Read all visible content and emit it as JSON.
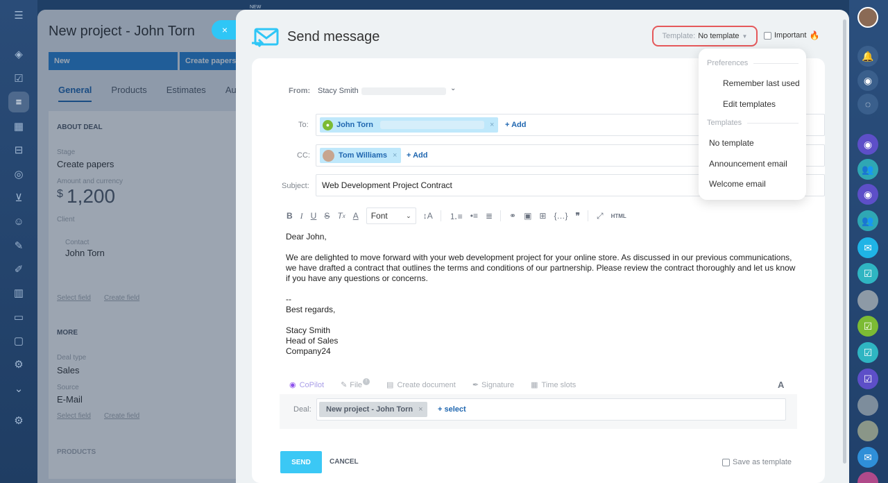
{
  "deal": {
    "title": "New project - John Torn",
    "stages": [
      "New",
      "Create papers"
    ],
    "tabs": [
      "General",
      "Products",
      "Estimates",
      "Aut"
    ],
    "section_about": "ABOUT DEAL",
    "stage_label": "Stage",
    "stage_value": "Create papers",
    "amount_label": "Amount and currency",
    "amount_currency": "$",
    "amount_value": "1,200",
    "client_label": "Client",
    "contact_label": "Contact",
    "contact_value": "John Torn",
    "select_field": "Select field",
    "create_field": "Create field",
    "section_more": "MORE",
    "deal_type_label": "Deal type",
    "deal_type_value": "Sales",
    "source_label": "Source",
    "source_value": "E-Mail",
    "select_field2": "Select field",
    "create_field2": "Create field",
    "products_label": "PRODUCTS"
  },
  "newtag": "NEW",
  "close_icon": "×",
  "slider": {
    "title": "Send message",
    "template_label": "Template:",
    "template_value": "No template",
    "important_label": "Important",
    "from_label": "From:",
    "from_value": "Stacy Smith",
    "to_label": "To:",
    "to_chip": "John Torn",
    "cc_label": "CC:",
    "cc_chip": "Tom Williams",
    "add_label": "+ Add",
    "subject_label": "Subject:",
    "subject_value": "Web Development Project Contract",
    "font_label": "Font",
    "body": {
      "greeting": "Dear John,",
      "para1": "We are delighted to move forward with your web development project for your online store. As discussed in our previous communications, we have drafted a contract that outlines the terms and conditions of our partnership. Please review the contract thoroughly and let us know if you have any questions or concerns.",
      "sig_dash": "--",
      "closing": "Best regards,",
      "name": "Stacy Smith",
      "role": "Head of Sales",
      "company": "Company24"
    },
    "actions": {
      "copilot": "CoPilot",
      "file": "File",
      "file_badge": "!",
      "create_doc": "Create document",
      "signature": "Signature",
      "time_slots": "Time slots"
    },
    "deal_label": "Deal:",
    "deal_chip": "New project - John Torn",
    "select_label": "+ select",
    "send": "SEND",
    "cancel": "CANCEL",
    "save_template": "Save as template"
  },
  "dropdown": {
    "preferences": "Preferences",
    "remember": "Remember last used",
    "edit": "Edit templates",
    "templates": "Templates",
    "items": [
      "No template",
      "Announcement email",
      "Welcome email"
    ]
  }
}
